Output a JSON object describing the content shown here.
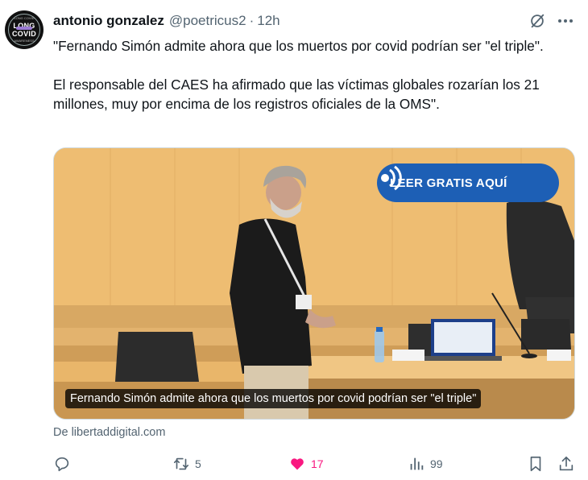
{
  "author": {
    "name": "antonio gonzalez",
    "handle": "@poetricus2",
    "separator": "·",
    "time": "12h",
    "avatar": {
      "line1": "LONG",
      "line2": "COVID",
      "ring_top": "LONG COVID",
      "ring_bottom": "AWARENESS"
    }
  },
  "tweet": {
    "paragraph1": "\"Fernando Simón admite ahora que los muertos por covid podrían ser \"el triple\".",
    "paragraph2": "El responsable del CAES ha afirmado que las víctimas globales rozarían los 21 millones, muy por encima de los registros oficiales de la OMS\"."
  },
  "media": {
    "cta_label": "LEER GRATIS AQUÍ",
    "caption": "Fernando Simón admite ahora que los muertos por covid podrían ser \"el triple\"",
    "source": "De libertaddigital.com"
  },
  "actions": {
    "replies": "",
    "retweets": "5",
    "likes": "17",
    "views": "99"
  },
  "colors": {
    "accent": "#1d9bf0",
    "like": "#f91880",
    "muted": "#536471",
    "cta": "#1d5fb5"
  },
  "icons": [
    "grok-icon",
    "more-icon",
    "reply-icon",
    "retweet-icon",
    "heart-icon",
    "views-icon",
    "bookmark-icon",
    "share-icon",
    "audio-icon"
  ]
}
